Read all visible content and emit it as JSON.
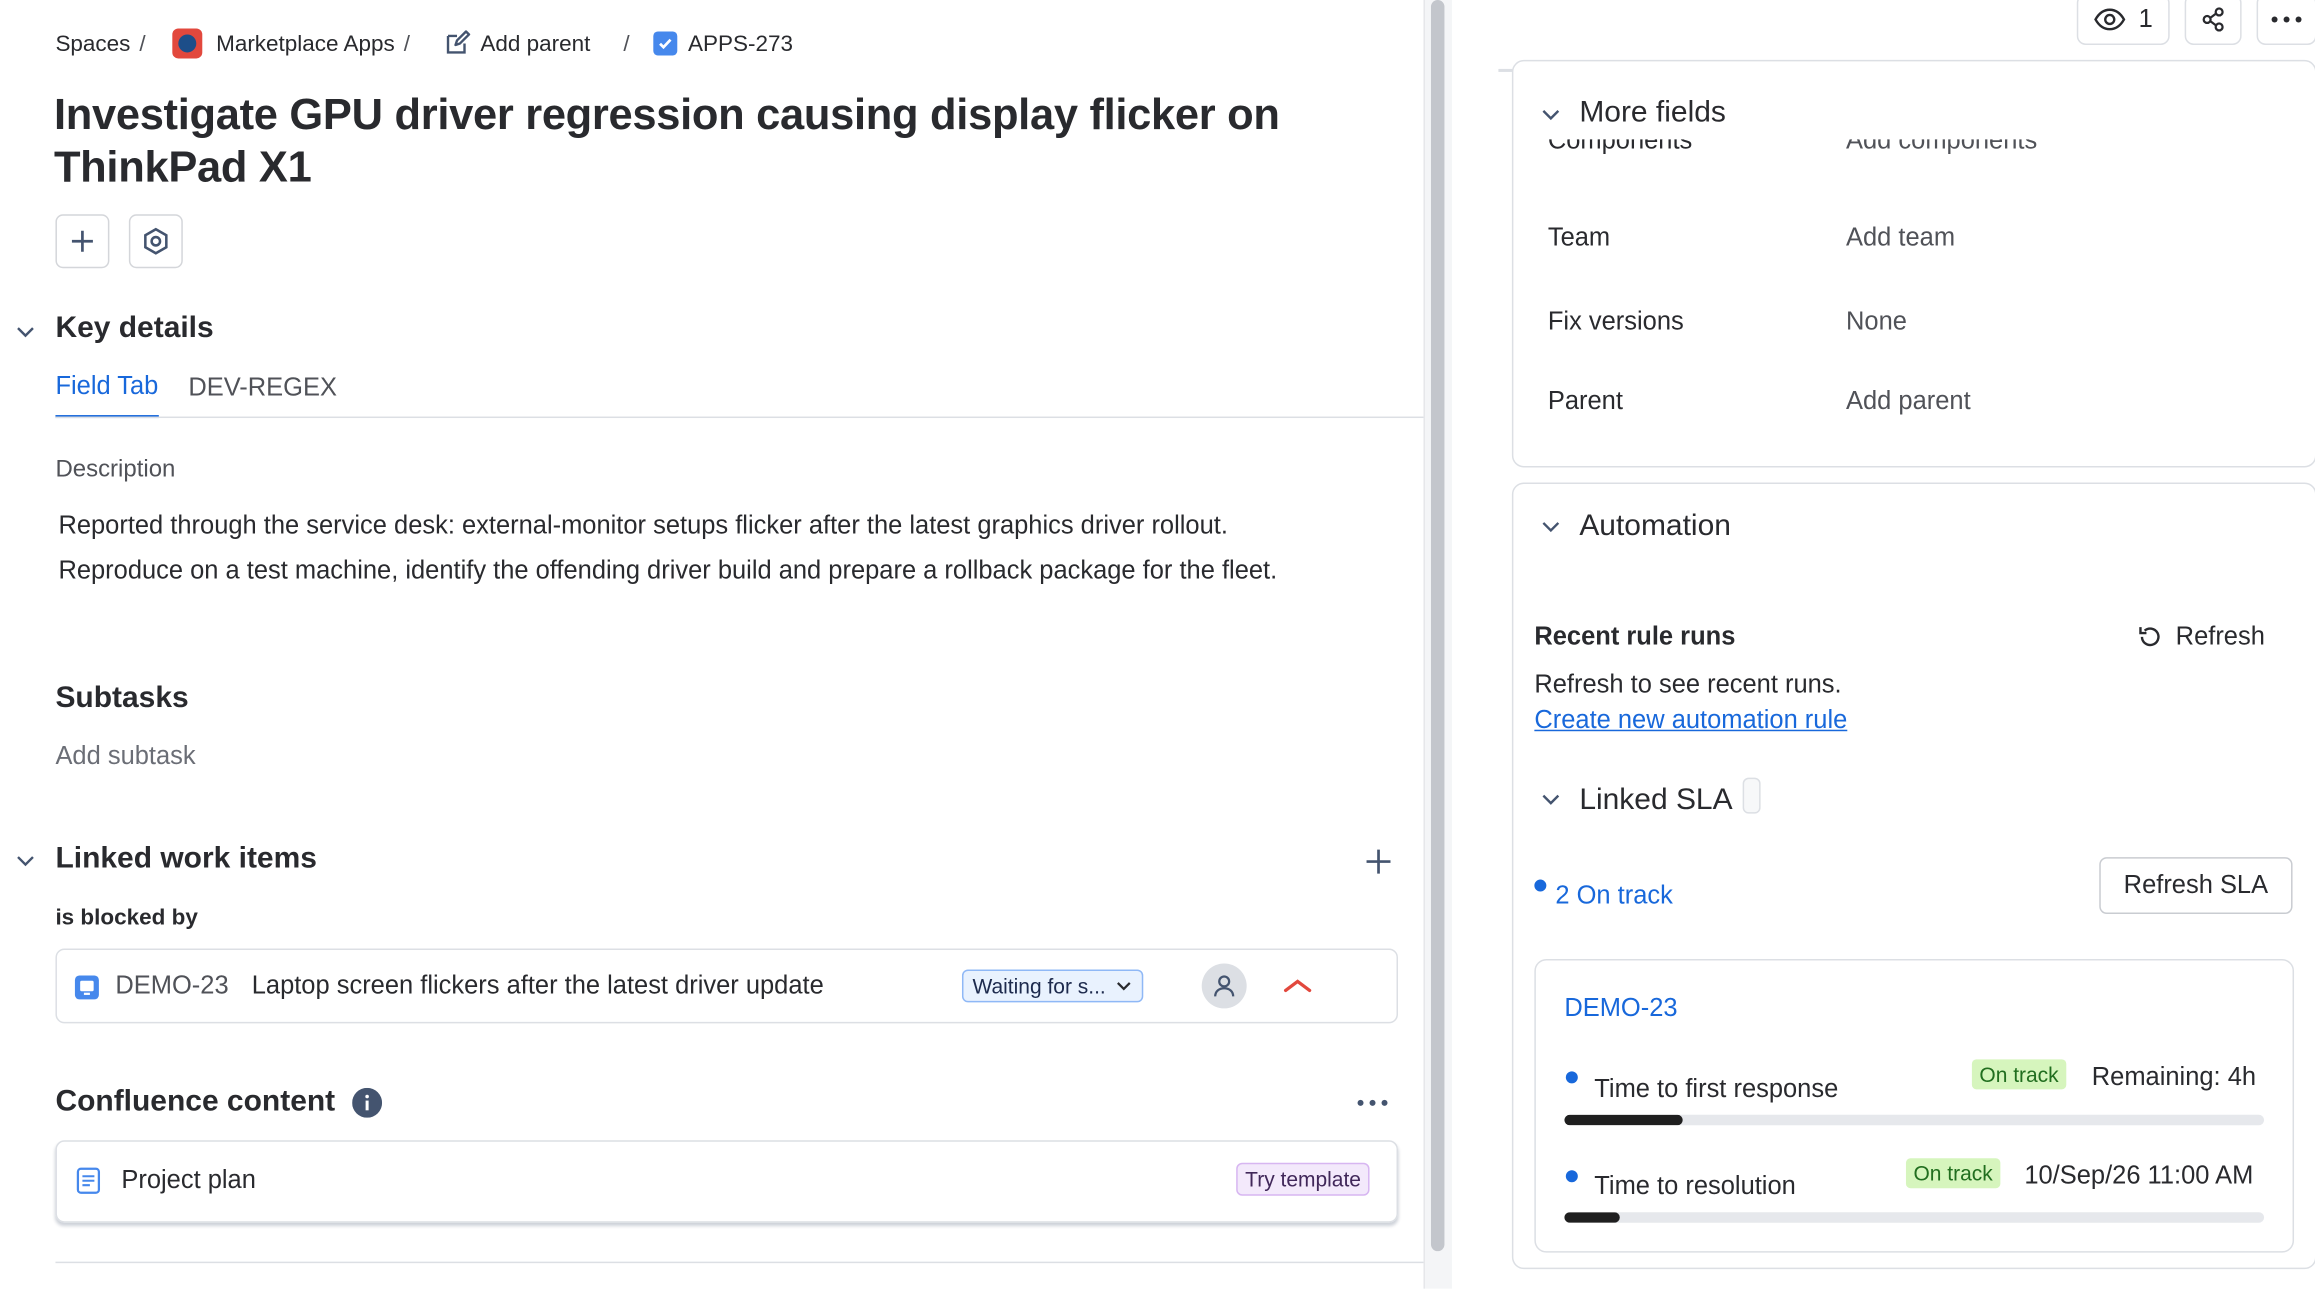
{
  "breadcrumb": {
    "spaces": "Spaces",
    "separator": "/",
    "app": "Marketplace Apps",
    "add_parent": "Add parent",
    "issue_key": "APPS-273"
  },
  "issue": {
    "title": "Investigate GPU driver regression causing display flicker on ThinkPad X1"
  },
  "key_details": {
    "heading": "Key details",
    "tabs": [
      {
        "label": "Field Tab",
        "active": true
      },
      {
        "label": "DEV-REGEX",
        "active": false
      }
    ],
    "description_label": "Description",
    "description_lines": [
      "Reported through the service desk: external-monitor setups flicker after the latest graphics driver rollout.",
      "Reproduce on a test machine, identify the offending driver build and prepare a rollback package for the fleet."
    ]
  },
  "subtasks": {
    "heading": "Subtasks",
    "add": "Add subtask"
  },
  "linked_items": {
    "heading": "Linked work items",
    "relation": "is blocked by",
    "items": [
      {
        "key": "DEMO-23",
        "summary": "Laptop screen flickers after the latest driver update",
        "status": "Waiting for s..."
      }
    ]
  },
  "confluence": {
    "heading": "Confluence content",
    "items": [
      {
        "title": "Project plan",
        "badge": "Try template"
      }
    ]
  },
  "header_actions": {
    "watchers": "1"
  },
  "more_fields": {
    "heading": "More fields",
    "clipped_label": "Components",
    "clipped_value": "Add components",
    "fields": [
      {
        "label": "Team",
        "value": "Add team"
      },
      {
        "label": "Fix versions",
        "value": "None"
      },
      {
        "label": "Parent",
        "value": "Add parent"
      }
    ]
  },
  "automation": {
    "heading": "Automation",
    "recent_runs": "Recent rule runs",
    "refresh": "Refresh",
    "hint": "Refresh to see recent runs.",
    "create_link": "Create new automation rule"
  },
  "linked_sla": {
    "heading": "Linked SLA",
    "on_track_summary": "2 On track",
    "refresh_button": "Refresh SLA",
    "card": {
      "key": "DEMO-23",
      "metrics": [
        {
          "name": "Time to first response",
          "status": "On track",
          "detail": "Remaining: 4h",
          "progress": 0.17
        },
        {
          "name": "Time to resolution",
          "status": "On track",
          "detail": "10/Sep/26 11:00 AM",
          "progress": 0.08
        }
      ]
    }
  },
  "colors": {
    "accent": "#1868db",
    "text": "#292a2e",
    "subtle": "#505258",
    "priority": "#e2483d",
    "on_track_bg": "#d6f5bd",
    "on_track_text": "#216e1f"
  }
}
